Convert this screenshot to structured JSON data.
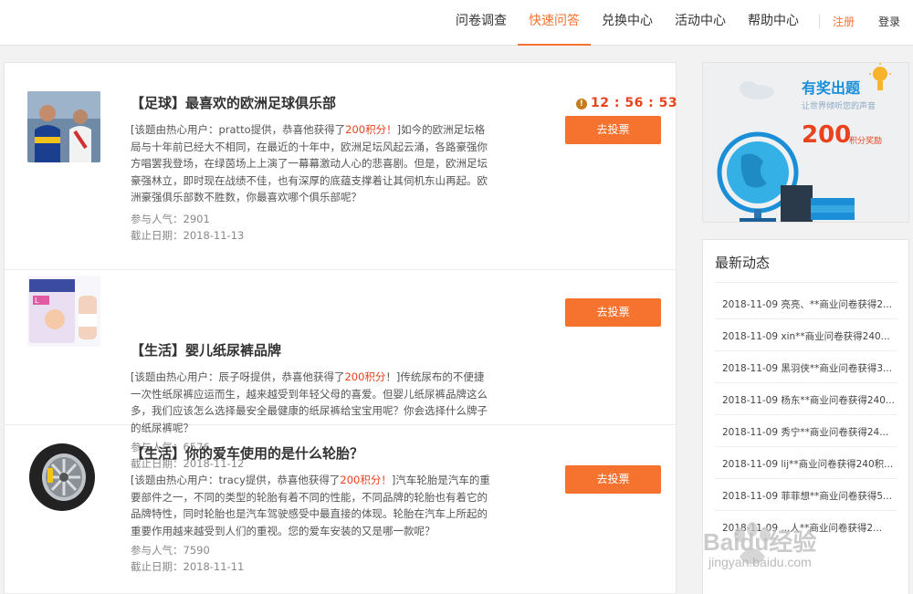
{
  "nav": {
    "items": [
      "问卷调查",
      "快速问答",
      "兑换中心",
      "活动中心",
      "帮助中心"
    ],
    "active_index": 1,
    "register": "注册",
    "login": "登录"
  },
  "questions": [
    {
      "title": "【足球】最喜欢的欧洲足球俱乐部",
      "desc_pre": "[该题由热心用户：pratto提供，恭喜他获得了",
      "points": "200积分！",
      "desc_post": "]如今的欧洲足坛格局与十年前已经大不相同，在最近的十年中，欧洲足坛风起云涌，各路豪强你方唱罢我登场，在绿茵场上上演了一幕幕激动人心的悲喜剧。但是，欧洲足坛豪强林立，即时现在战绩不佳，也有深厚的底蕴支撑着让其伺机东山再起。欧洲豪强俱乐部数不胜数，你最喜欢哪个俱乐部呢？",
      "popularity": "参与人气：2901",
      "deadline": "截止日期：2018-11-13",
      "timer": "12 : 56 : 53",
      "vote": "去投票"
    },
    {
      "title": "【生活】婴儿纸尿裤品牌",
      "desc_pre": "[该题由热心用户：辰子呀提供，恭喜他获得了",
      "points": "200积分",
      "desc_post": "！]传统尿布的不便捷一次性纸尿裤应运而生，越来越受到年轻父母的喜爱。但婴儿纸尿裤品牌这么多，我们应该怎么选择最安全最健康的纸尿裤给宝宝用呢？你会选择什么牌子的纸尿裤呢？",
      "popularity": "参与人气：6576",
      "deadline": "截止日期：2018-11-12",
      "vote": "去投票"
    },
    {
      "title": "【生活】你的爱车使用的是什么轮胎？",
      "desc_pre": "[该题由热心用户：tracy提供，恭喜他获得了",
      "points": "200积分！",
      "desc_post": "]汽车轮胎是汽车的重要部件之一，不同的类型的轮胎有着不同的性能，不同品牌的轮胎也有着它的品牌特性，同时轮胎也是汽车驾驶感受中最直接的体现。轮胎在汽车上所起的重要作用越来越受到人们的重视。您的爱车安装的又是哪一款呢？",
      "popularity": "参与人气：7590",
      "deadline": "截止日期：2018-11-11",
      "vote": "去投票"
    }
  ],
  "banner": {
    "title": "有奖出题",
    "subtitle": "让世界倾听您的声音",
    "number": "200",
    "unit": "积分奖励"
  },
  "news": {
    "title": "最新动态",
    "items": [
      "2018-11-09 亮亮、**商业问卷获得2...",
      "2018-11-09 xin**商业问卷获得240...",
      "2018-11-09 黑羽侠**商业问卷获得3...",
      "2018-11-09 杨东**商业问卷获得240...",
      "2018-11-09 秀宁**商业问卷获得24...",
      "2018-11-09 lij**商业问卷获得240积...",
      "2018-11-09 菲菲想**商业问卷获得5...",
      "2018-11-09 ...人**商业问卷获得2..."
    ]
  },
  "colors": {
    "accent": "#f5722f",
    "points": "#e8431d",
    "banner_blue": "#1a8fd8"
  },
  "watermark": {
    "brand": "Baidu经验",
    "url": "jingyan.baidu.com"
  }
}
